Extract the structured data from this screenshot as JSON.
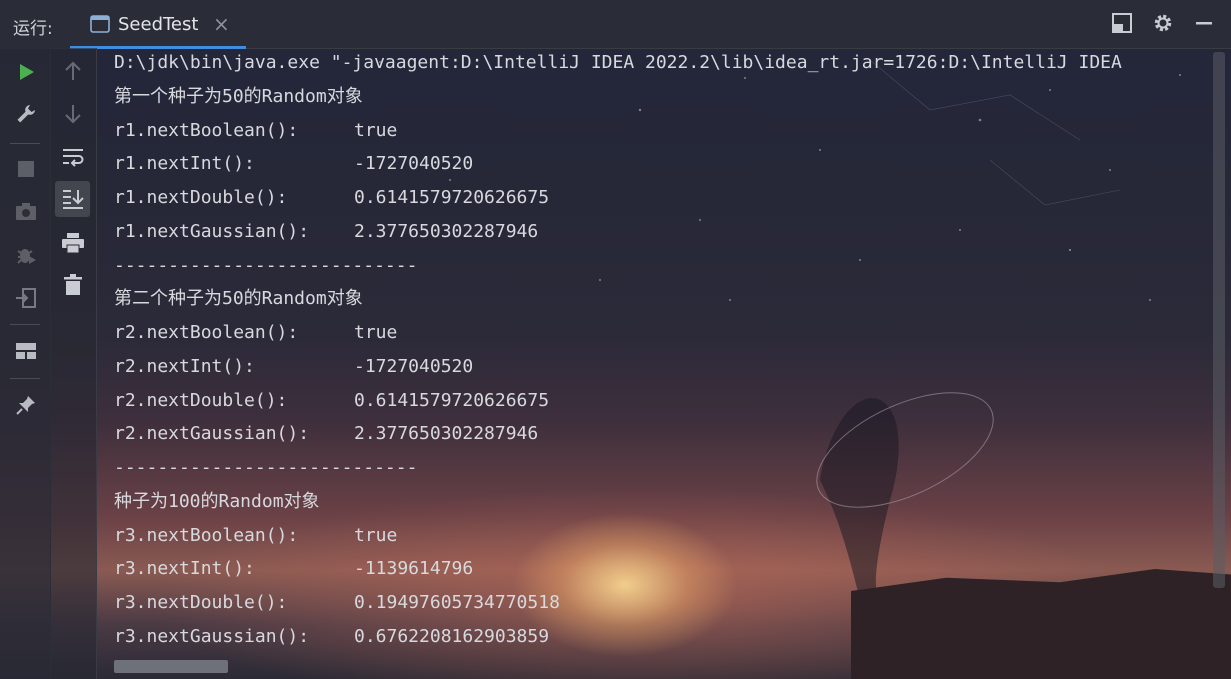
{
  "app": {
    "run_label": "运行:",
    "tab_title": "SeedTest",
    "tab_close": "×"
  },
  "toolbar_icons": [
    "layout-icon",
    "gear-icon",
    "minimize-icon"
  ],
  "left_tools": [
    "run-icon",
    "wrench-icon",
    "stop-icon",
    "camera-icon",
    "debug-icon",
    "login-icon",
    "layout-grid-icon",
    "pin-icon"
  ],
  "console_tools": [
    "arrow-up-icon",
    "arrow-down-icon",
    "soft-wrap-icon",
    "scroll-to-end-icon",
    "print-icon",
    "trash-icon"
  ],
  "console": {
    "command": "D:\\jdk\\bin\\java.exe \"-javaagent:D:\\IntelliJ IDEA 2022.2\\lib\\idea_rt.jar=1726:D:\\IntelliJ IDEA",
    "header1": "第一个种子为50的Random对象",
    "r1": [
      {
        "label": "r1.nextBoolean():",
        "value": "true"
      },
      {
        "label": "r1.nextInt():",
        "value": "-1727040520"
      },
      {
        "label": "r1.nextDouble():",
        "value": "0.6141579720626675"
      },
      {
        "label": "r1.nextGaussian():",
        "value": "2.377650302287946"
      }
    ],
    "divider1": "----------------------------",
    "header2": "第二个种子为50的Random对象",
    "r2": [
      {
        "label": "r2.nextBoolean():",
        "value": "true"
      },
      {
        "label": "r2.nextInt():",
        "value": "-1727040520"
      },
      {
        "label": "r2.nextDouble():",
        "value": "0.6141579720626675"
      },
      {
        "label": "r2.nextGaussian():",
        "value": "2.377650302287946"
      }
    ],
    "divider2": "----------------------------",
    "header3": "种子为100的Random对象",
    "r3": [
      {
        "label": "r3.nextBoolean():",
        "value": "true"
      },
      {
        "label": "r3.nextInt():",
        "value": "-1139614796"
      },
      {
        "label": "r3.nextDouble():",
        "value": "0.19497605734770518"
      },
      {
        "label": "r3.nextGaussian():",
        "value": "0.6762208162903859"
      }
    ]
  },
  "colors": {
    "run_green": "#4caf50",
    "tab_underline": "#3d8ee0",
    "text": "#d7d9de"
  }
}
